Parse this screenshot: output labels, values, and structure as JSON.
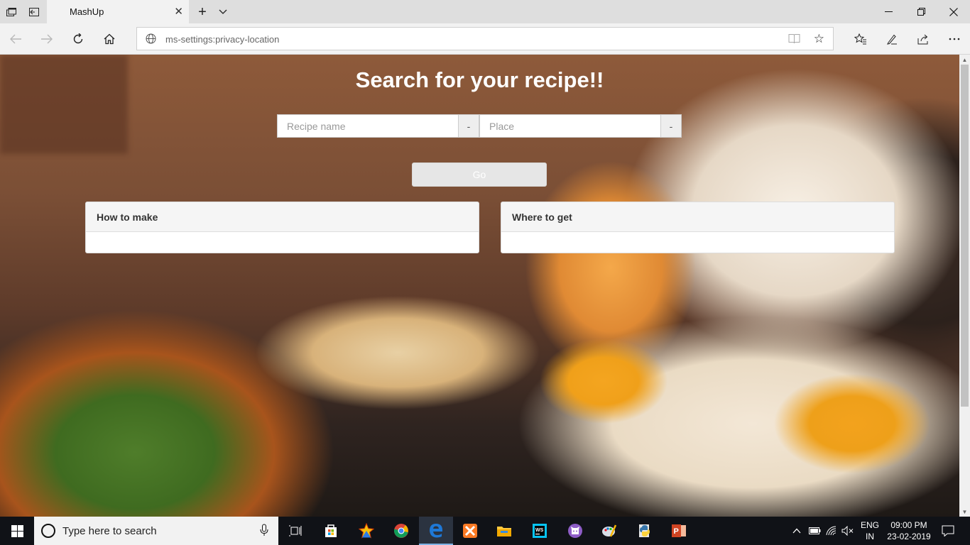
{
  "browser": {
    "tab_title": "MashUp",
    "address": "ms-settings:privacy-location"
  },
  "page": {
    "heading": "Search for your recipe!!",
    "recipe_placeholder": "Recipe name",
    "place_placeholder": "Place",
    "addon_symbol": "-",
    "go_label": "Go",
    "panels": [
      {
        "title": "How to make"
      },
      {
        "title": "Where to get"
      }
    ]
  },
  "taskbar": {
    "search_placeholder": "Type here to search",
    "language_top": "ENG",
    "language_bottom": "IN",
    "time": "09:00 PM",
    "date": "23-02-2019"
  },
  "colors": {
    "taskbar_bg": "#101217",
    "edge_blue": "#1e78d7",
    "page_heading": "#ffffff"
  }
}
